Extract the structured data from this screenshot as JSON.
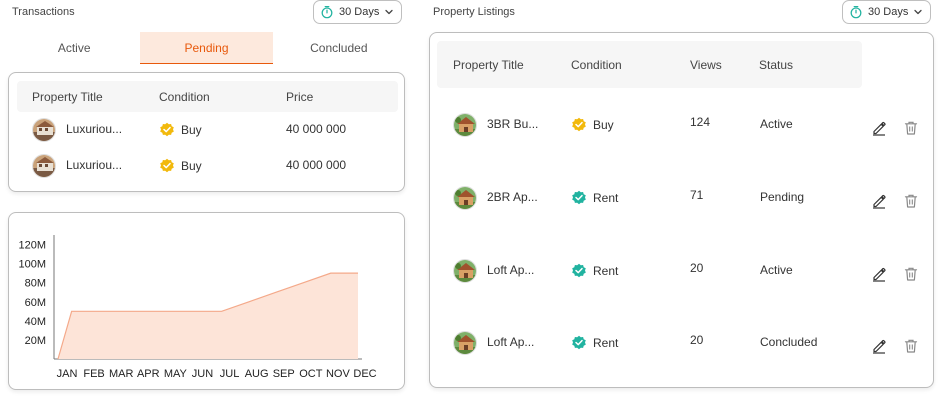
{
  "transactions": {
    "title": "Transactions",
    "range_label": "30 Days",
    "tabs": [
      {
        "label": "Active",
        "active": false
      },
      {
        "label": "Pending",
        "active": true
      },
      {
        "label": "Concluded",
        "active": false
      }
    ],
    "columns": [
      "Property Title",
      "Condition",
      "Price"
    ],
    "rows": [
      {
        "title": "Luxuriou...",
        "condition": "Buy",
        "price": "40 000 000"
      },
      {
        "title": "Luxuriou...",
        "condition": "Buy",
        "price": "40 000 000"
      }
    ]
  },
  "chart_data": {
    "type": "area",
    "categories": [
      "JAN",
      "FEB",
      "MAR",
      "APR",
      "MAY",
      "JUN",
      "JUL",
      "AUG",
      "SEP",
      "OCT",
      "NOV",
      "DEC"
    ],
    "x": [
      0,
      0.5,
      1,
      2,
      3,
      4,
      5,
      6,
      7,
      8,
      9,
      10,
      11
    ],
    "values": [
      0,
      50000000,
      50000000,
      50000000,
      50000000,
      50000000,
      50000000,
      50000000,
      60000000,
      70000000,
      80000000,
      90000000,
      90000000
    ],
    "y_ticks": [
      "20M",
      "40M",
      "60M",
      "80M",
      "100M",
      "120M"
    ],
    "y_tick_values": [
      20000000,
      40000000,
      60000000,
      80000000,
      100000000,
      120000000
    ],
    "ylim": [
      0,
      130000000
    ],
    "color": "#f4a98a",
    "fill": "#fde4d8",
    "grid": false
  },
  "listings": {
    "title": "Property Listings",
    "range_label": "30 Days",
    "columns": [
      "Property Title",
      "Condition",
      "Views",
      "Status"
    ],
    "rows": [
      {
        "title": "3BR Bu...",
        "condition": "Buy",
        "condition_type": "buy",
        "views": "124",
        "status": "Active"
      },
      {
        "title": "2BR Ap...",
        "condition": "Rent",
        "condition_type": "rent",
        "views": "71",
        "status": "Pending"
      },
      {
        "title": "Loft Ap...",
        "condition": "Rent",
        "condition_type": "rent",
        "views": "20",
        "status": "Active"
      },
      {
        "title": "Loft Ap...",
        "condition": "Rent",
        "condition_type": "rent",
        "views": "20",
        "status": "Concluded"
      }
    ],
    "row_actions": {
      "edit_icon": "pencil-icon",
      "delete_icon": "trash-icon"
    }
  },
  "colors": {
    "accent": "#e8590c",
    "buy_badge": "#f2b90c",
    "rent_badge": "#21b3a0",
    "timer": "#21b3a0"
  }
}
